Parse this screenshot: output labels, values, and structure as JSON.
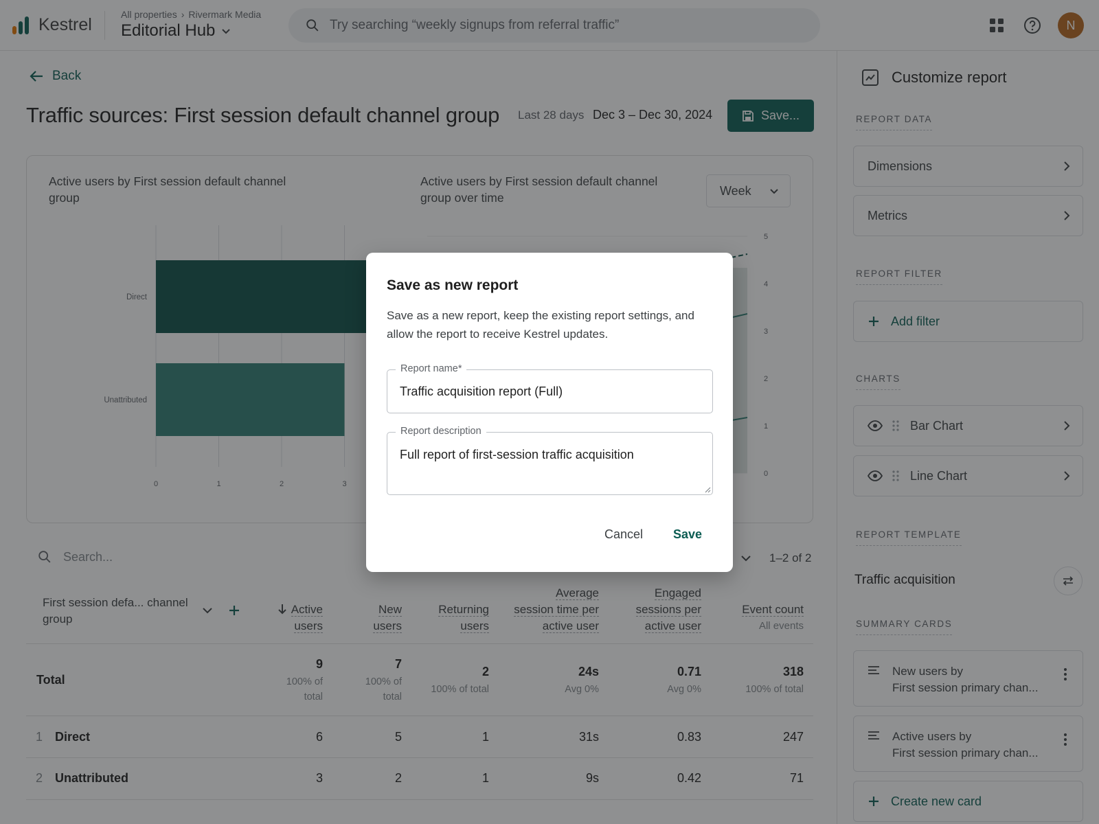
{
  "app": {
    "name": "Kestrel"
  },
  "header": {
    "breadcrumb": [
      "All properties",
      "Rivermark Media"
    ],
    "property_name": "Editorial Hub",
    "search_placeholder": "Try searching “weekly signups from referral traffic”",
    "avatar_initial": "N"
  },
  "main": {
    "back_label": "Back",
    "title": "Traffic sources: First session default channel group",
    "range_label": "Last 28 days",
    "range_value": "Dec 3 – Dec 30, 2024",
    "save_label": "Save..."
  },
  "charts": {
    "bar_title": "Active users by First session default channel group",
    "line_title": "Active users by First session default channel group over time",
    "granularity": "Week"
  },
  "chart_data": [
    {
      "type": "bar",
      "orientation": "horizontal",
      "categories": [
        "Direct",
        "Unattributed"
      ],
      "values": [
        6,
        3
      ],
      "xticks": [
        "0",
        "1",
        "2",
        "3"
      ],
      "color": "#0d4f47"
    },
    {
      "type": "line",
      "yticks": [
        "0",
        "1",
        "2",
        "3",
        "4",
        "5"
      ]
    }
  ],
  "table": {
    "search_placeholder": "Search...",
    "pagination": "1–2 of 2",
    "dimension_header": "First session defa... channel group",
    "columns": [
      {
        "line1": "",
        "line2": "Active",
        "line3": "users"
      },
      {
        "line1": "",
        "line2": "New",
        "line3": "users"
      },
      {
        "line1": "",
        "line2": "Returning",
        "line3": "users"
      },
      {
        "line1": "Average",
        "line2": "session time per",
        "line3": "active user"
      },
      {
        "line1": "Engaged",
        "line2": "sessions per",
        "line3": "active user"
      },
      {
        "line1": "",
        "line2": "Event count",
        "line3": "All events"
      }
    ],
    "total": {
      "label": "Total",
      "values": [
        "9",
        "7",
        "2",
        "24s",
        "0.71",
        "318"
      ],
      "subs": [
        "100% of total",
        "100% of total",
        "100% of total",
        "Avg 0%",
        "Avg 0%",
        "100% of total"
      ]
    },
    "rows": [
      {
        "index": "1",
        "name": "Direct",
        "values": [
          "6",
          "5",
          "1",
          "31s",
          "0.83",
          "247"
        ]
      },
      {
        "index": "2",
        "name": "Unattributed",
        "values": [
          "3",
          "2",
          "1",
          "9s",
          "0.42",
          "71"
        ]
      }
    ]
  },
  "panel": {
    "title": "Customize report",
    "report_data_label": "REPORT DATA",
    "dimensions_label": "Dimensions",
    "metrics_label": "Metrics",
    "report_filter_label": "REPORT FILTER",
    "add_filter_label": "Add filter",
    "charts_label": "CHARTS",
    "chart_items": [
      "Bar Chart",
      "Line Chart"
    ],
    "template_label": "REPORT TEMPLATE",
    "template_name": "Traffic acquisition",
    "summary_cards_label": "SUMMARY CARDS",
    "cards": [
      {
        "line1": "New users by",
        "line2": "First session primary chan..."
      },
      {
        "line1": "Active users by",
        "line2": "First session primary chan..."
      }
    ],
    "create_card_label": "Create new card"
  },
  "dialog": {
    "title": "Save as new report",
    "description": "Save as a new report, keep the existing report settings, and allow the report to receive Kestrel updates.",
    "name_label": "Report name*",
    "name_value": "Traffic acquisition report (Full)",
    "desc_label": "Report description",
    "desc_value": "Full report of first-session traffic acquisition",
    "cancel_label": "Cancel",
    "save_label": "Save"
  },
  "colors": {
    "brand": "#0b5c52",
    "bar_primary": "#0d4f47",
    "bar_secondary": "#2e7d72",
    "logo_orange": "#e37400",
    "logo_teal": "#0b5c52"
  }
}
